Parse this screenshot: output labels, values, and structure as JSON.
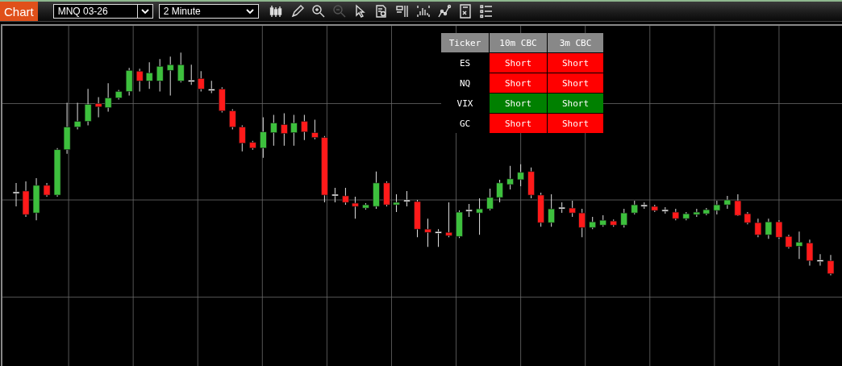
{
  "toolbar": {
    "tab": {
      "label": "Chart",
      "selected": true
    },
    "symbol": {
      "value": "MNQ 03-26"
    },
    "interval": {
      "value": "2 Minute"
    },
    "tools": [
      {
        "disabled": false
      },
      {
        "disabled": false
      },
      {
        "disabled": false
      },
      {
        "disabled": true
      },
      {
        "disabled": false
      },
      {
        "disabled": false
      },
      {
        "disabled": false
      },
      {
        "disabled": false
      },
      {
        "disabled": false
      },
      {
        "disabled": false
      },
      {
        "disabled": false
      }
    ]
  },
  "signal_table": {
    "columns": [
      "Ticker",
      "10m CBC",
      "3m CBC"
    ],
    "rows": [
      {
        "cells": [
          {
            "text": "ES"
          },
          {
            "text": "Short",
            "color": "#ff0000"
          },
          {
            "text": "Short",
            "color": "#ff0000"
          }
        ]
      },
      {
        "cells": [
          {
            "text": "NQ"
          },
          {
            "text": "Short",
            "color": "#ff0000"
          },
          {
            "text": "Short",
            "color": "#ff0000"
          }
        ]
      },
      {
        "cells": [
          {
            "text": "VIX"
          },
          {
            "text": "Short",
            "color": "#008000"
          },
          {
            "text": "Short",
            "color": "#008000"
          }
        ]
      },
      {
        "cells": [
          {
            "text": "GC"
          },
          {
            "text": "Short",
            "color": "#ff0000"
          },
          {
            "text": "Short",
            "color": "#ff0000"
          }
        ]
      }
    ]
  }
}
